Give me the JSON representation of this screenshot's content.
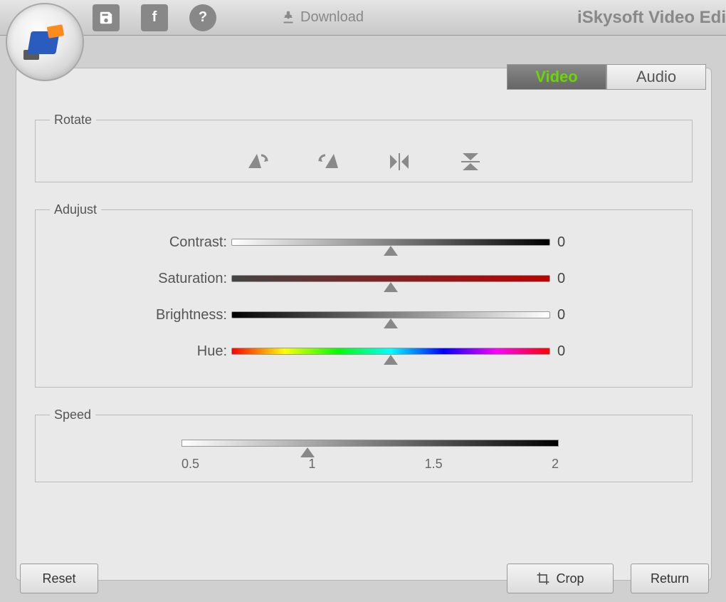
{
  "app": {
    "title": "iSkysoft Video Edi"
  },
  "toolbar": {
    "download_label": "Download"
  },
  "tabs": {
    "video": "Video",
    "audio": "Audio"
  },
  "groups": {
    "rotate": "Rotate",
    "adjust": "Adujust",
    "speed": "Speed"
  },
  "adjust": {
    "contrast": {
      "label": "Contrast:",
      "value": "0"
    },
    "saturation": {
      "label": "Saturation:",
      "value": "0"
    },
    "brightness": {
      "label": "Brightness:",
      "value": "0"
    },
    "hue": {
      "label": "Hue:",
      "value": "0"
    }
  },
  "speed": {
    "ticks": [
      "0.5",
      "1",
      "1.5",
      "2"
    ]
  },
  "buttons": {
    "reset": "Reset",
    "crop": "Crop",
    "return": "Return"
  }
}
